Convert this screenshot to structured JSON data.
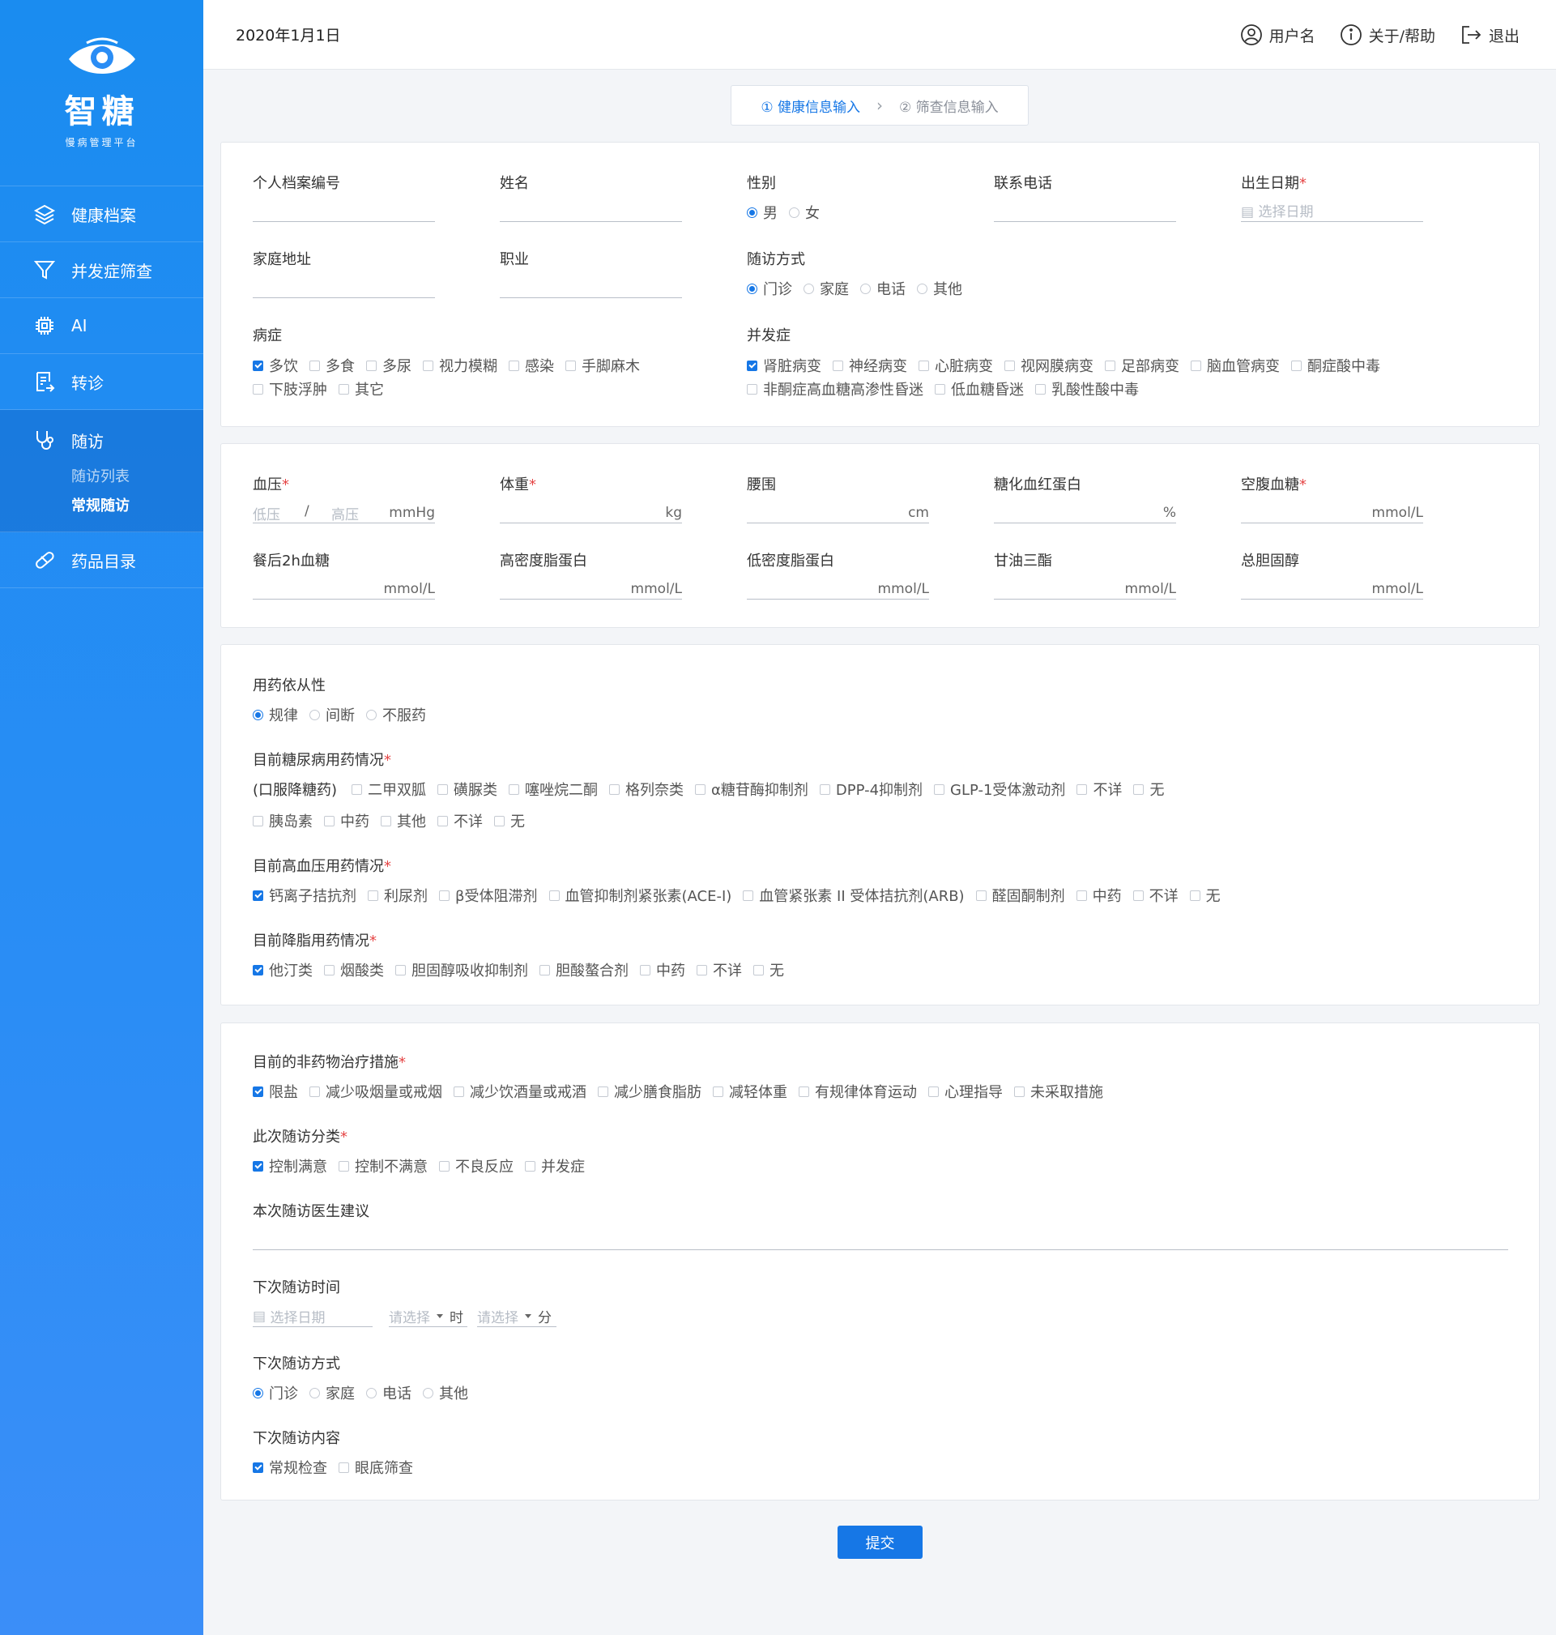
{
  "app": {
    "name": "智糖",
    "subtitle": "慢病管理平台"
  },
  "sidebar": {
    "items": [
      {
        "label": "健康档案",
        "icon": "layers-icon"
      },
      {
        "label": "并发症筛查",
        "icon": "filter-icon"
      },
      {
        "label": "AI",
        "icon": "chip-icon"
      },
      {
        "label": "转诊",
        "icon": "document-icon"
      }
    ],
    "followup": {
      "label": "随访",
      "icon": "stethoscope-icon",
      "sub": [
        "随访列表",
        "常规随访"
      ]
    },
    "drug": {
      "label": "药品目录",
      "icon": "pill-icon"
    }
  },
  "header": {
    "date": "2020年1月1日",
    "user": "用户名",
    "help": "关于/帮助",
    "logout": "退出"
  },
  "steps": {
    "step1": "① 健康信息输入",
    "step2": "② 筛查信息输入"
  },
  "section1": {
    "fields": {
      "file_no": "个人档案编号",
      "name": "姓名",
      "gender": "性别",
      "phone": "联系电话",
      "birth": "出生日期",
      "birth_placeholder": "选择日期",
      "address": "家庭地址",
      "job": "职业",
      "visit_method": "随访方式"
    },
    "gender_options": [
      "男",
      "女"
    ],
    "visit_options": [
      "门诊",
      "家庭",
      "电话",
      "其他"
    ],
    "symptoms_label": "病症",
    "symptoms_row1": [
      "多饮",
      "多食",
      "多尿",
      "视力模糊",
      "感染",
      "手脚麻木"
    ],
    "symptoms_row2": [
      "下肢浮肿",
      "其它"
    ],
    "complications_label": "并发症",
    "complications_row1": [
      "肾脏病变",
      "神经病变",
      "心脏病变",
      "视网膜病变",
      "足部病变",
      "脑血管病变",
      "酮症酸中毒"
    ],
    "complications_row2": [
      "非酮症高血糖高渗性昏迷",
      "低血糖昏迷",
      "乳酸性酸中毒"
    ]
  },
  "section2": {
    "bp": "血压",
    "bp_low": "低压",
    "bp_high": "高压",
    "bp_sep": "/",
    "bp_unit": "mmHg",
    "weight": "体重",
    "weight_unit": "kg",
    "waist": "腰围",
    "waist_unit": "cm",
    "hba1c": "糖化血红蛋白",
    "hba1c_unit": "%",
    "fpg": "空腹血糖",
    "fpg_unit": "mmol/L",
    "pg2h": "餐后2h血糖",
    "pg2h_unit": "mmol/L",
    "hdl": "高密度脂蛋白",
    "hdl_unit": "mmol/L",
    "ldl": "低密度脂蛋白",
    "ldl_unit": "mmol/L",
    "tg": "甘油三酯",
    "tg_unit": "mmol/L",
    "tc": "总胆固醇",
    "tc_unit": "mmol/L"
  },
  "section3": {
    "adherence_label": "用药依从性",
    "adherence_options": [
      "规律",
      "间断",
      "不服药"
    ],
    "diabetes_label": "目前糖尿病用药情况",
    "oral_prefix": "(口服降糖药)",
    "diabetes_row1": [
      "二甲双胍",
      "磺脲类",
      "噻唑烷二酮",
      "格列奈类",
      "α糖苷酶抑制剂",
      "DPP-4抑制剂",
      "GLP-1受体激动剂",
      "不详",
      "无"
    ],
    "diabetes_row2": [
      "胰岛素",
      "中药",
      "其他",
      "不详",
      "无"
    ],
    "hypertension_label": "目前高血压用药情况",
    "hypertension_options": [
      "钙离子拮抗剂",
      "利尿剂",
      "β受体阻滞剂",
      "血管抑制剂紧张素(ACE-I)",
      "血管紧张素 II 受体拮抗剂(ARB)",
      "醛固酮制剂",
      "中药",
      "不详",
      "无"
    ],
    "lipid_label": "目前降脂用药情况",
    "lipid_options": [
      "他汀类",
      "烟酸类",
      "胆固醇吸收抑制剂",
      "胆酸螯合剂",
      "中药",
      "不详",
      "无"
    ]
  },
  "section4": {
    "nondrug_label": "目前的非药物治疗措施",
    "nondrug_options": [
      "限盐",
      "减少吸烟量或戒烟",
      "减少饮酒量或戒酒",
      "减少膳食脂肪",
      "减轻体重",
      "有规律体育运动",
      "心理指导",
      "未采取措施"
    ],
    "category_label": "此次随访分类",
    "category_options": [
      "控制满意",
      "控制不满意",
      "不良反应",
      "并发症"
    ],
    "advice_label": "本次随访医生建议",
    "next_time_label": "下次随访时间",
    "date_placeholder": "选择日期",
    "select_placeholder": "请选择",
    "hour": "时",
    "minute": "分",
    "next_method_label": "下次随访方式",
    "next_method_options": [
      "门诊",
      "家庭",
      "电话",
      "其他"
    ],
    "next_content_label": "下次随访内容",
    "next_content_options": [
      "常规检查",
      "眼底筛查"
    ]
  },
  "submit": "提交",
  "colors": {
    "primary": "#1677e6",
    "sidebar": "#1a8cf0",
    "required": "#e54545"
  }
}
